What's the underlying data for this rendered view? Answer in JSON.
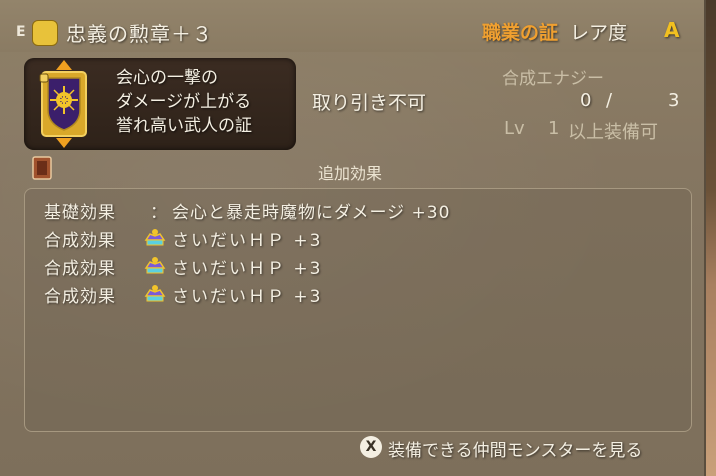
{
  "header": {
    "equip_mark": "E",
    "item_icon": "coin-icon",
    "item_name": "忠義の勲章＋３",
    "category": "職業の証",
    "rarity_label": "レア度",
    "rarity_value": "A"
  },
  "item_card": {
    "emblem_icon": "job-emblem-icon",
    "description_lines": [
      "会心の一撃の",
      "ダメージが上がる",
      "誉れ高い武人の証"
    ]
  },
  "info": {
    "tradable": "取り引き不可",
    "energy_label": "合成エナジー",
    "energy_current": "0",
    "energy_separator": "/",
    "energy_max": "3",
    "lv_label": "Lv",
    "lv_value": "1",
    "lv_suffix": "以上装備可"
  },
  "effects": {
    "heading": "追加効果",
    "book_icon": "book-icon",
    "base": {
      "label": "基礎効果",
      "colon": "：",
      "text": "会心と暴走時魔物にダメージ +30"
    },
    "synth": [
      {
        "label": "合成効果",
        "icon": "gem-icon",
        "text": "さいだいＨＰ +3"
      },
      {
        "label": "合成効果",
        "icon": "gem-icon",
        "text": "さいだいＨＰ +3"
      },
      {
        "label": "合成効果",
        "icon": "gem-icon",
        "text": "さいだいＨＰ +3"
      }
    ]
  },
  "footer": {
    "button_glyph": "X",
    "text": "装備できる仲間モンスターを見る"
  },
  "colors": {
    "category": "#f0a030",
    "rarity": "#f2c020",
    "panel": "#857661"
  }
}
